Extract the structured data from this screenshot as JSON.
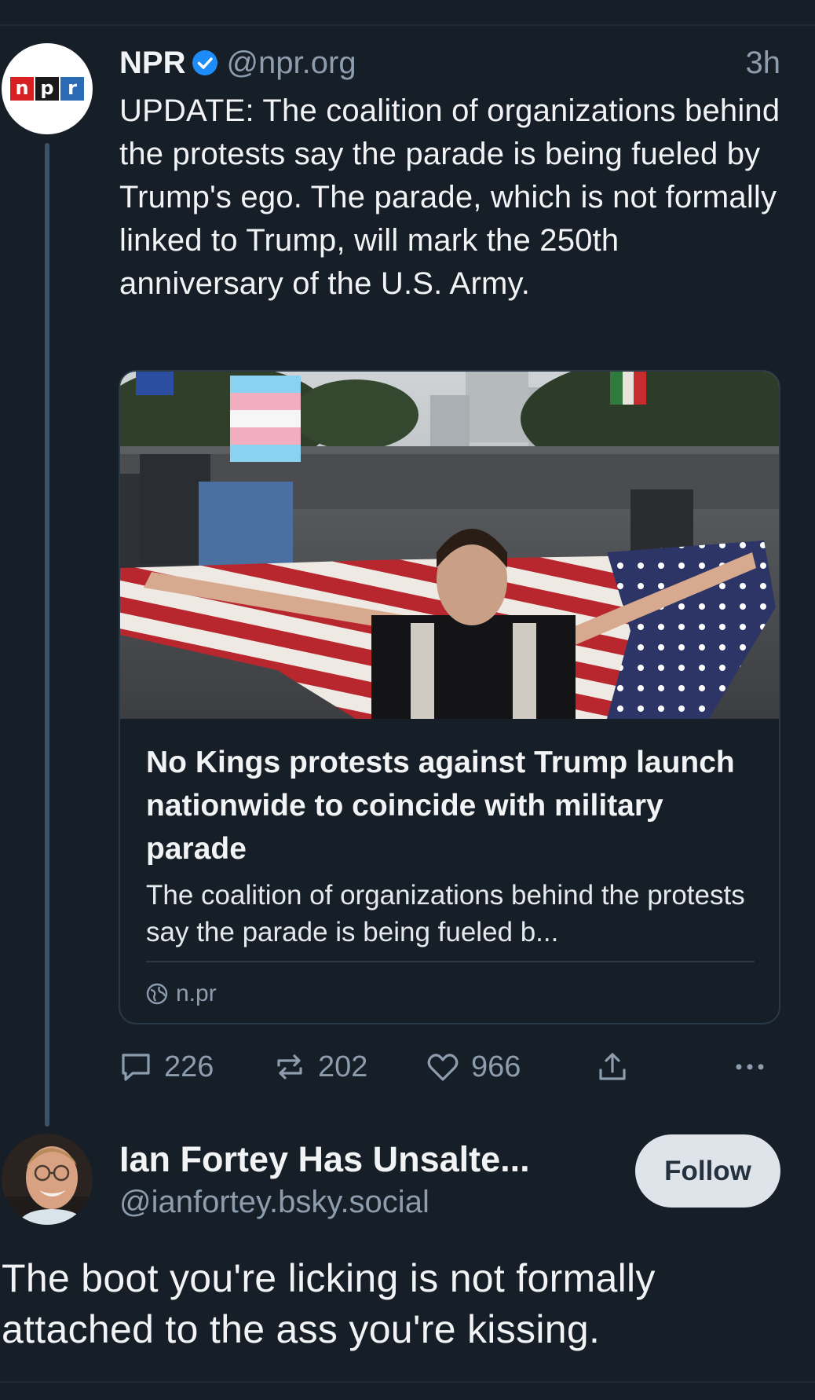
{
  "parent_post": {
    "author_name": "NPR",
    "author_handle": "@npr.org",
    "time": "3h",
    "avatar_logo_letters": [
      "n",
      "p",
      "r"
    ],
    "avatar_logo_colors": [
      "#d62021",
      "#1a1a1a",
      "#2b6bb3"
    ],
    "text": "UPDATE: The coalition of organizations behind the protests say the parade is being fueled by Trump's ego. The parade, which is not formally linked to Trump, will mark the 250th anniversary of the U.S. Army.",
    "link_card": {
      "image_description_icon": "protest-photo",
      "title": "No Kings protests against Trump launch nationwide to coincide with military parade",
      "description": "The coalition of organizations behind the protests say the parade is being fueled b...",
      "domain": "n.pr"
    },
    "actions": {
      "reply_count": "226",
      "repost_count": "202",
      "like_count": "966"
    }
  },
  "reply_post": {
    "author_name": "Ian Fortey Has Unsalte...",
    "author_handle": "@ianfortey.bsky.social",
    "follow_label": "Follow",
    "text": "The boot you're licking is not formally attached to the ass you're kissing."
  },
  "colors": {
    "background": "#161e27",
    "muted_text": "#8d9dae",
    "verified_blue": "#1d8cf8",
    "thread_line": "#3b5268"
  }
}
